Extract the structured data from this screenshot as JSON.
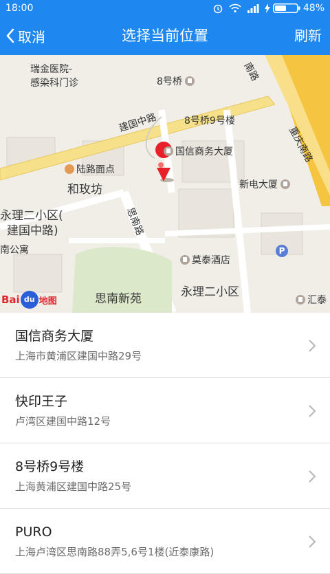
{
  "status_bar": {
    "time": "18:00",
    "battery": "48%"
  },
  "nav": {
    "back_label": "取消",
    "title": "选择当前位置",
    "refresh_label": "刷新"
  },
  "map": {
    "labels": {
      "ruijin": "瑞金医院-",
      "ruijin2": "感染科门诊",
      "bahaoqiao": "8号桥",
      "jianguozhonglu": "建国中路",
      "bahaoqiao9": "8号桥9号楼",
      "guoxin": "国信商务大厦",
      "lulu": "陆路面点",
      "hemeifang": "和玫坊",
      "xindian": "新电大厦",
      "yongli_a": "永理二小区(",
      "yongli_b": "建国中路)",
      "sinanlu": "思南路",
      "nangongyu": "南公寓",
      "motai": "莫泰酒店",
      "yongli2": "永理二小区",
      "sinanxinyuan": "思南新苑",
      "huitai": "汇泰",
      "chongqingnanlu": "重庆南路",
      "nanlu": "南路",
      "parking": "P"
    },
    "logo": {
      "bai": "Bai",
      "du": "du",
      "ditu": "地图"
    }
  },
  "places": [
    {
      "name": "国信商务大厦",
      "address": "上海市黄浦区建国中路29号"
    },
    {
      "name": "快印王子",
      "address": "卢湾区建国中路12号"
    },
    {
      "name": "8号桥9号楼",
      "address": "上海黄浦区建国中路25号"
    },
    {
      "name": "PURO",
      "address": "上海卢湾区思南路88弄5,6号1楼(近泰康路)"
    }
  ],
  "colors": {
    "primary": "#1e88f0",
    "road_yellow": "#f7d56a",
    "highway": "#f5c542",
    "marker": "#e8202a"
  }
}
